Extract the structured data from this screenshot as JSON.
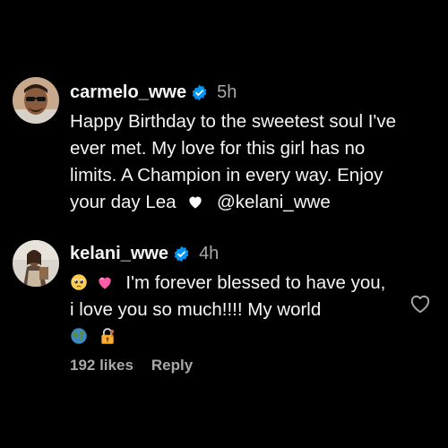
{
  "colors": {
    "background": "#000000",
    "text": "#f5f5f5",
    "muted": "#a8a8a8",
    "verified": "#0095f6"
  },
  "comments": [
    {
      "username": "carmelo_wwe",
      "time": "5h",
      "verified_icon": "verified-badge-icon",
      "text": "Happy Birthday to the sweetest soul I've ever met. My love for this girl has no limits. A Champion in every way. Enjoy your day Lea",
      "emoji_after": "white-heart-icon",
      "mention": "@kelani_wwe"
    },
    {
      "username": "kelani_wwe",
      "time": "4h",
      "verified_icon": "verified-badge-icon",
      "emoji_before": [
        "pleading-face-icon",
        "pink-heart-icon"
      ],
      "text": "I'm forever blessed to have you, i love you so much!!!! My world",
      "emoji_after": [
        "globe-icon",
        "lock-with-key-icon"
      ],
      "likes": "192 likes",
      "reply_label": "Reply",
      "like_icon": "heart-outline-icon"
    }
  ]
}
